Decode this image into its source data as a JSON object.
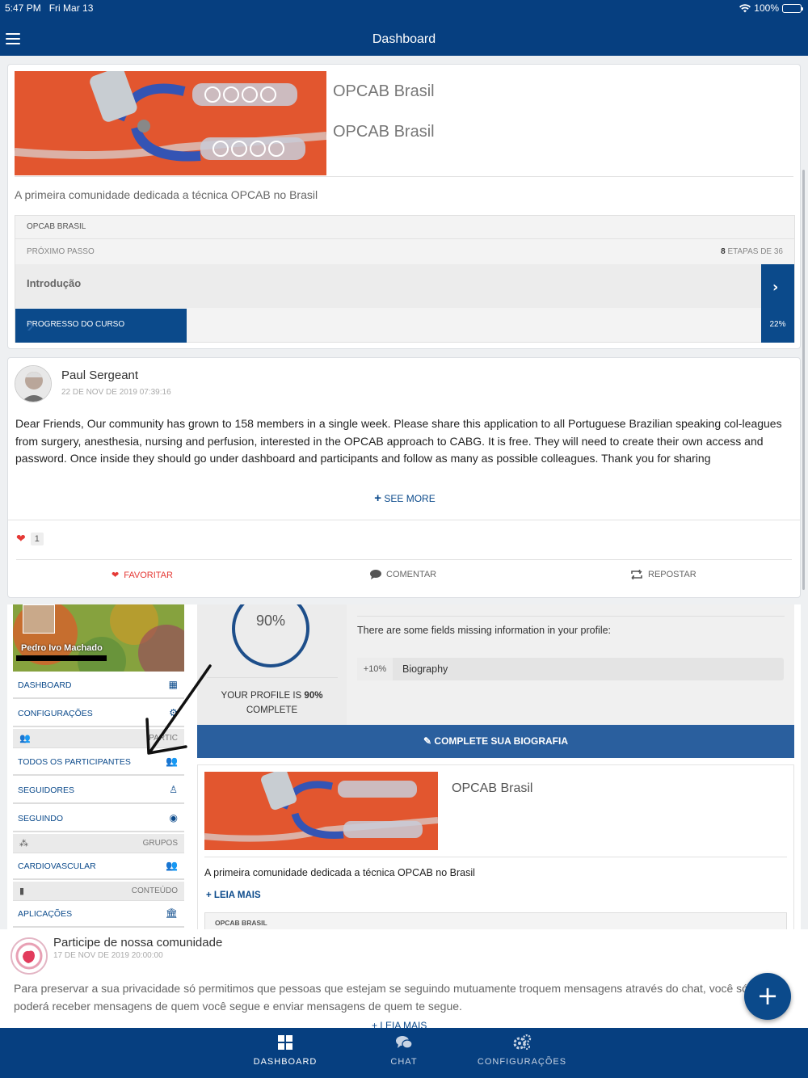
{
  "status": {
    "time": "5:47 PM",
    "date": "Fri Mar 13",
    "battery": "100%"
  },
  "nav": {
    "title": "Dashboard"
  },
  "course": {
    "title_1": "OPCAB Brasil",
    "title_2": "OPCAB Brasil",
    "description": "A primeira comunidade dedicada a técnica OPCAB no Brasil",
    "box_title": "OPCAB BRASIL",
    "next_step_label": "PRÓXIMO PASSO",
    "steps_done": "8",
    "steps_rest": "ETAPAS DE 36",
    "lesson": "Introdução",
    "progress_label": "PROGRESSO DO CURSO",
    "progress_percent": "22%",
    "progress_value": 0.22
  },
  "post": {
    "author": "Paul Sergeant",
    "timestamp": "22 DE NOV DE 2019 07:39:16",
    "body": "Dear Friends, Our community has grown to 158 members in a single week. Please share this application to all Portuguese Brazilian speaking col-leagues from surgery, anesthesia, nursing and perfusion, interested in the OPCAB approach to CABG. It is free. They will need to create their own access and password. Once inside they should go under dashboard and participants and follow as many as possible colleagues. Thank you for sharing",
    "see_more": "SEE MORE",
    "likes": "1",
    "actions": {
      "favorite": "FAVORITAR",
      "comment": "COMENTAR",
      "repost": "REPOSTAR"
    }
  },
  "embedded": {
    "user_name": "Pedro Ivo Machado",
    "menu": {
      "dashboard": "DASHBOARD",
      "settings": "CONFIGURAÇÕES",
      "participants_header": "PARTIC",
      "all_participants": "TODOS OS PARTICIPANTES",
      "followers": "SEGUIDORES",
      "following": "SEGUINDO",
      "groups_header": "GRUPOS",
      "cardiovascular": "CARDIOVASCULAR",
      "content_header": "CONTEÚDO",
      "applications": "APLICAÇÕES"
    },
    "profile_percent": "90%",
    "profile_value": 0.9,
    "profile_text_prefix": "YOUR PROFILE IS",
    "profile_text_bold": "90%",
    "profile_text_suffix": "COMPLETE",
    "missing_info": "There are some fields missing information in your profile:",
    "bio_pct": "+10%",
    "bio_label": "Biography",
    "complete_bio_button": "COMPLETE SUA BIOGRAFIA",
    "course_title": "OPCAB Brasil",
    "course_desc": "A primeira comunidade dedicada a técnica OPCAB no Brasil",
    "read_more": "LEIA MAIS",
    "course_box_title": "OPCAB BRASIL"
  },
  "community": {
    "title": "Participe de nossa comunidade",
    "timestamp": "17 DE NOV DE 2019 20:00:00",
    "body": "Para preservar a sua privacidade só permitimos que pessoas que estejam se seguindo mutuamente troquem mensagens através do chat, você só poderá receber mensagens de quem você segue e enviar mensagens de quem te segue.",
    "read_more": "LEIA MAIS"
  },
  "tabs": [
    {
      "label": "DASHBOARD",
      "icon": "grid-icon",
      "active": true
    },
    {
      "label": "CHAT",
      "icon": "chat-icon",
      "active": false
    },
    {
      "label": "CONFIGURAÇÕES",
      "icon": "gears-icon",
      "active": false
    }
  ],
  "colors": {
    "primary": "#063f80",
    "accent": "#0b4a8b",
    "favorite": "#e53935"
  }
}
